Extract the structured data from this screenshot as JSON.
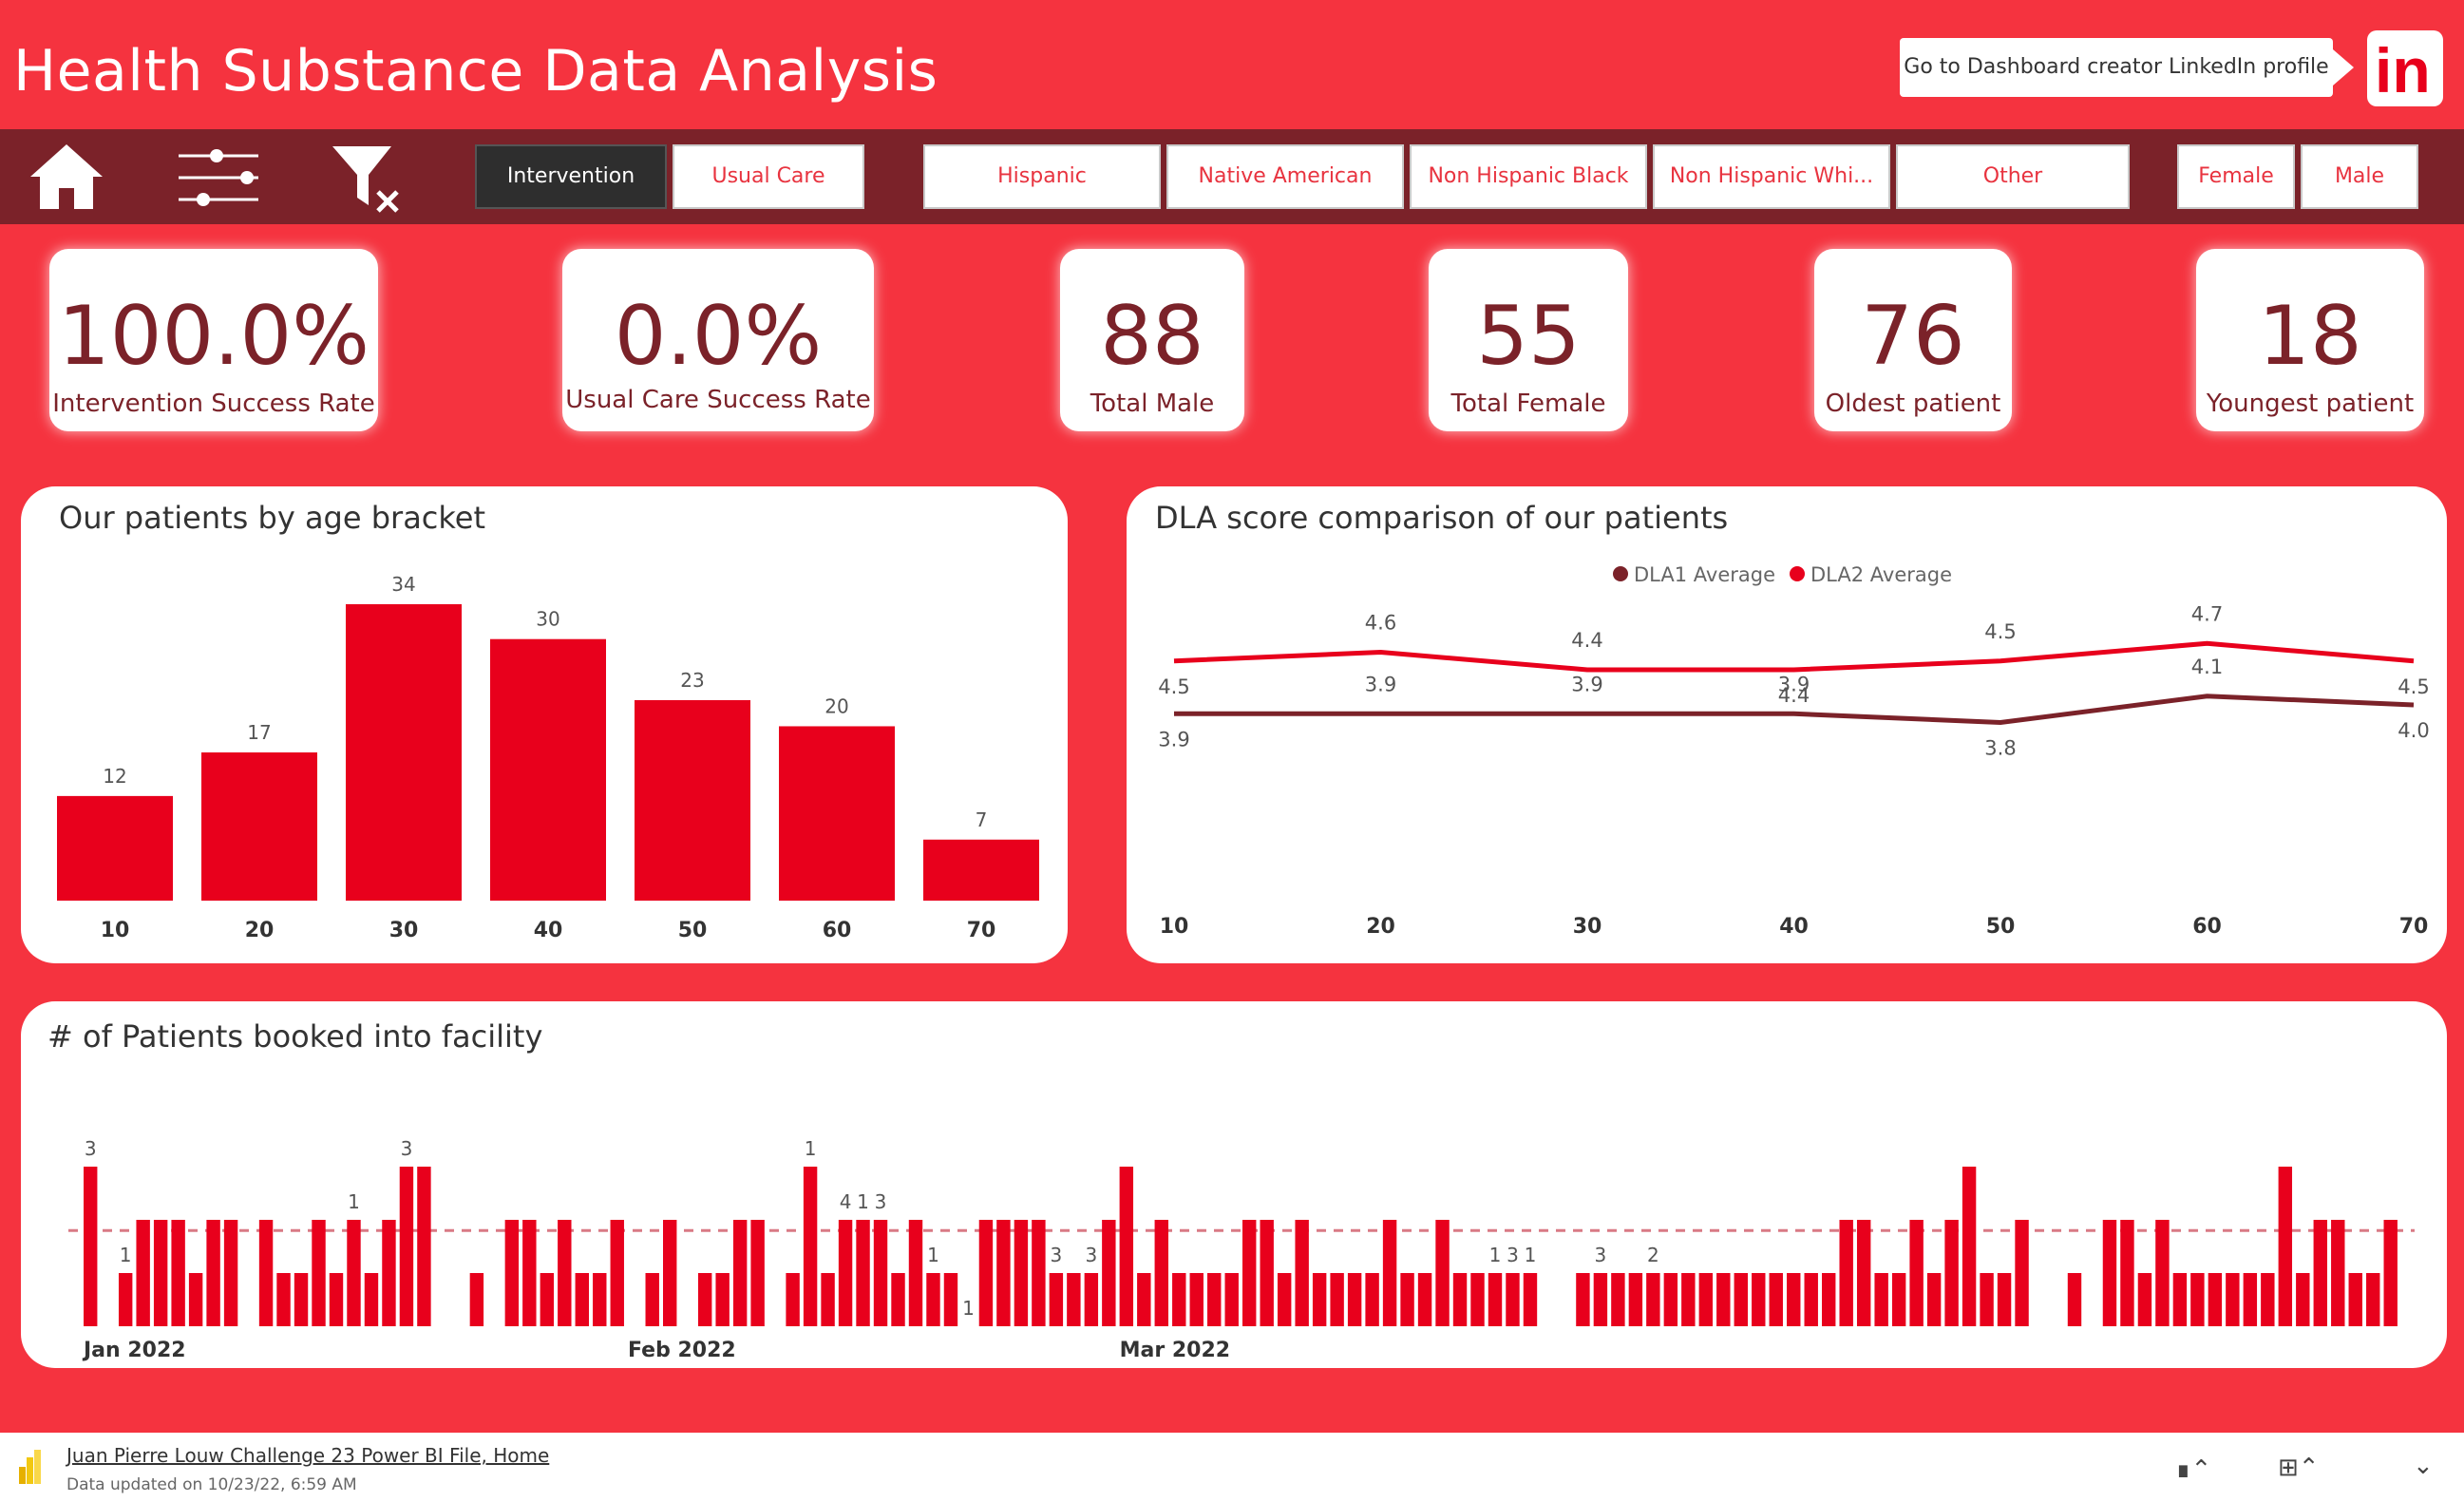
{
  "header": {
    "title": "Health Substance Data Analysis",
    "linkedin_button": "Go to Dashboard creator LinkedIn profile",
    "linkedin_logo": "in"
  },
  "nav": {
    "icons": [
      "home-icon",
      "sliders-icon",
      "clear-filter-icon"
    ],
    "care_slicer": [
      {
        "label": "Intervention",
        "selected": true
      },
      {
        "label": "Usual Care",
        "selected": false
      }
    ],
    "ethnicity_slicer": [
      {
        "label": "Hispanic"
      },
      {
        "label": "Native American"
      },
      {
        "label": "Non Hispanic Black"
      },
      {
        "label": "Non Hispanic Whi..."
      },
      {
        "label": "Other"
      }
    ],
    "gender_slicer": [
      {
        "label": "Female"
      },
      {
        "label": "Male"
      }
    ]
  },
  "kpis": [
    {
      "value": "100.0%",
      "label": "Intervention Success Rate"
    },
    {
      "value": "0.0%",
      "label": "Usual Care Success Rate"
    },
    {
      "value": "88",
      "label": "Total Male"
    },
    {
      "value": "55",
      "label": "Total Female"
    },
    {
      "value": "76",
      "label": "Oldest patient"
    },
    {
      "value": "18",
      "label": "Youngest patient"
    }
  ],
  "colors": {
    "background": "#f5333f",
    "bar": "#e8001c",
    "dark": "#7b2229",
    "line_dla1": "#7b2229",
    "line_dla2": "#e8001c"
  },
  "chart_data": [
    {
      "type": "bar",
      "title": "Our patients by age bracket",
      "categories": [
        "10",
        "20",
        "30",
        "40",
        "50",
        "60",
        "70"
      ],
      "values": [
        12,
        17,
        34,
        30,
        23,
        20,
        7
      ],
      "data_labels": true,
      "ylim": [
        0,
        34
      ],
      "grid": false
    },
    {
      "type": "line",
      "title": "DLA score comparison of our patients",
      "x": [
        "10",
        "20",
        "30",
        "40",
        "50",
        "60",
        "70"
      ],
      "series": [
        {
          "name": "DLA1 Average",
          "values": [
            3.9,
            3.9,
            3.9,
            3.9,
            3.8,
            4.1,
            4.0
          ],
          "labels": [
            "3.9",
            "3.9",
            "3.9",
            "3.9",
            "3.8",
            "4.1",
            "4.0"
          ]
        },
        {
          "name": "DLA2 Average",
          "values": [
            4.5,
            4.6,
            4.4,
            4.4,
            4.5,
            4.7,
            4.5
          ],
          "labels": [
            "4.5",
            "4.6",
            "4.4",
            "4.4",
            "4.5",
            "4.7",
            "4.5"
          ]
        }
      ],
      "legend": "top-center",
      "grid": false
    },
    {
      "type": "bar",
      "title": "# of Patients booked into facility",
      "x_tick_labels": [
        "Jan 2022",
        "Feb 2022",
        "Mar 2022"
      ],
      "x_tick_indices": [
        0,
        31,
        59
      ],
      "values": [
        3,
        0,
        1,
        2,
        2,
        2,
        1,
        2,
        2,
        0,
        2,
        1,
        1,
        2,
        1,
        2,
        1,
        2,
        3,
        3,
        0,
        0,
        1,
        0,
        2,
        2,
        1,
        2,
        1,
        1,
        2,
        0,
        1,
        2,
        0,
        1,
        1,
        2,
        2,
        0,
        1,
        3,
        1,
        2,
        2,
        2,
        1,
        2,
        1,
        1,
        0,
        2,
        2,
        2,
        2,
        1,
        1,
        1,
        2,
        3,
        1,
        2,
        1,
        1,
        1,
        1,
        2,
        2,
        1,
        2,
        1,
        1,
        1,
        1,
        2,
        1,
        1,
        2,
        1,
        1,
        1,
        1,
        1,
        0,
        0,
        1,
        1,
        1,
        1,
        1,
        1,
        1,
        1,
        1,
        1,
        1,
        1,
        1,
        1,
        1,
        2,
        2,
        1,
        1,
        2,
        1,
        2,
        3,
        1,
        1,
        2,
        0,
        0,
        1,
        0,
        2,
        2,
        1,
        2,
        1,
        1,
        1,
        1,
        1,
        1,
        3,
        1,
        2,
        2,
        1,
        1,
        2
      ],
      "bar_labels": [
        {
          "index": 0,
          "text": "3"
        },
        {
          "index": 2,
          "text": "1"
        },
        {
          "index": 15,
          "text": "1"
        },
        {
          "index": 18,
          "text": "3"
        },
        {
          "index": 41,
          "text": "1"
        },
        {
          "index": 43,
          "text": "4"
        },
        {
          "index": 44,
          "text": "1"
        },
        {
          "index": 45,
          "text": "3"
        },
        {
          "index": 48,
          "text": "1"
        },
        {
          "index": 50,
          "text": "1"
        },
        {
          "index": 55,
          "text": "3"
        },
        {
          "index": 57,
          "text": "3"
        },
        {
          "index": 80,
          "text": "1"
        },
        {
          "index": 81,
          "text": "3"
        },
        {
          "index": 82,
          "text": "1"
        },
        {
          "index": 86,
          "text": "3"
        },
        {
          "index": 89,
          "text": "2"
        }
      ],
      "average_line": 1.8,
      "ylim": [
        0,
        4
      ]
    }
  ],
  "footer": {
    "file_link": "Juan Pierre Louw Challenge 23 Power BI File, Home",
    "updated": "Data updated on 10/23/22, 6:59 AM"
  }
}
